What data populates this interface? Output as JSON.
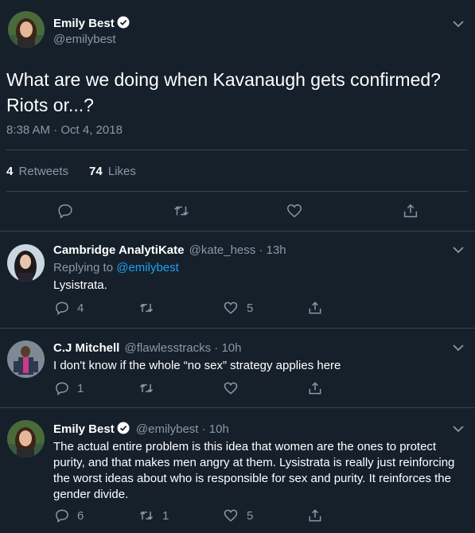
{
  "main_tweet": {
    "author_name": "Emily Best",
    "author_handle": "@emilybest",
    "text_line1": "What are we doing when Kavanaugh gets confirmed?",
    "text_line2": "Riots or...?",
    "timestamp": "8:38 AM · Oct 4, 2018",
    "retweets_count": "4",
    "retweets_label": "Retweets",
    "likes_count": "74",
    "likes_label": "Likes"
  },
  "replies": [
    {
      "author_name": "Cambridge AnalytiKate",
      "author_handle": "@kate_hess",
      "time": "· 13h",
      "replying_prefix": "Replying to",
      "replying_handle": "@emilybest",
      "text": "Lysistrata.",
      "reply_count": "4",
      "retweet_count": "",
      "like_count": "5"
    },
    {
      "author_name": "C.J Mitchell",
      "author_handle": "@flawlesstracks",
      "time": "· 10h",
      "text": "I don't know if the whole “no sex” strategy applies here",
      "reply_count": "1",
      "retweet_count": "",
      "like_count": ""
    },
    {
      "author_name": "Emily Best",
      "author_handle": "@emilybest",
      "time": "· 10h",
      "text_lines": [
        "The actual entire problem is this idea that women are the ones to protect",
        "purity, and that makes men angry at them. Lysistrata is really just reinforcing",
        "the worst ideas about who is responsible for sex and purity. It reinforces the",
        "gender divide."
      ],
      "reply_count": "6",
      "retweet_count": "1",
      "like_count": "5"
    }
  ],
  "icons": {
    "reply": "reply-icon",
    "retweet": "retweet-icon",
    "like": "heart-icon",
    "share": "share-icon",
    "more": "chevron-down-icon",
    "verified": "verified-badge-icon"
  },
  "colors": {
    "background": "#15202b",
    "muted": "#8899a6",
    "link": "#1da1f2",
    "divider": "#38444d"
  }
}
